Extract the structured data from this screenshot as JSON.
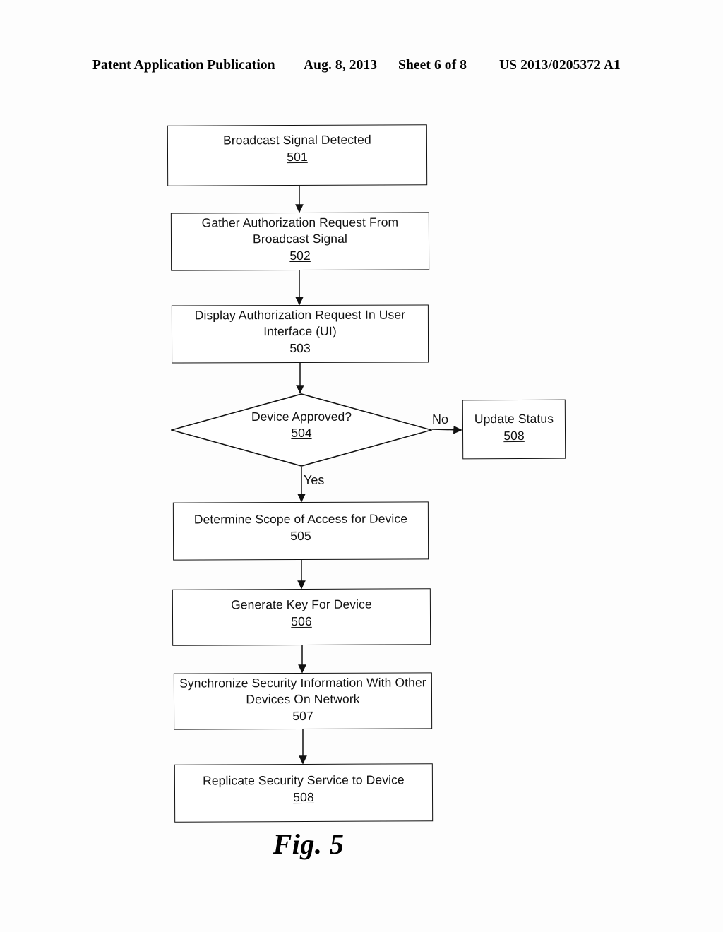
{
  "header": {
    "publication": "Patent Application Publication",
    "date": "Aug. 8, 2013",
    "sheet": "Sheet 6 of 8",
    "patent_number": "US 2013/0205372 A1"
  },
  "figure": {
    "caption": "Fig. 5"
  },
  "flowchart": {
    "nodes": [
      {
        "id": "501",
        "shape": "process",
        "title": "Broadcast Signal Detected",
        "ref": "501"
      },
      {
        "id": "502",
        "shape": "process",
        "title": "Gather Authorization Request From Broadcast Signal",
        "ref": "502"
      },
      {
        "id": "503",
        "shape": "process",
        "title": "Display Authorization Request In User Interface (UI)",
        "ref": "503"
      },
      {
        "id": "504",
        "shape": "decision",
        "title": "Device Approved?",
        "ref": "504"
      },
      {
        "id": "505",
        "shape": "process",
        "title": "Determine Scope of Access for Device",
        "ref": "505"
      },
      {
        "id": "506",
        "shape": "process",
        "title": "Generate Key For Device",
        "ref": "506"
      },
      {
        "id": "507",
        "shape": "process",
        "title": "Synchronize Security Information With Other Devices On Network",
        "ref": "507"
      },
      {
        "id": "508b",
        "shape": "process",
        "title": "Replicate Security Service to Device",
        "ref": "508"
      },
      {
        "id": "508",
        "shape": "process",
        "title": "Update Status",
        "ref": "508"
      }
    ],
    "edges": [
      {
        "from": "501",
        "to": "502",
        "label": ""
      },
      {
        "from": "502",
        "to": "503",
        "label": ""
      },
      {
        "from": "503",
        "to": "504",
        "label": ""
      },
      {
        "from": "504",
        "to": "508",
        "label": "No"
      },
      {
        "from": "504",
        "to": "505",
        "label": "Yes"
      },
      {
        "from": "505",
        "to": "506",
        "label": ""
      },
      {
        "from": "506",
        "to": "507",
        "label": ""
      },
      {
        "from": "507",
        "to": "508b",
        "label": ""
      }
    ],
    "branch_labels": {
      "yes": "Yes",
      "no": "No"
    }
  },
  "colors": {
    "ink": "#111111",
    "paper": "#fdfdfd"
  }
}
